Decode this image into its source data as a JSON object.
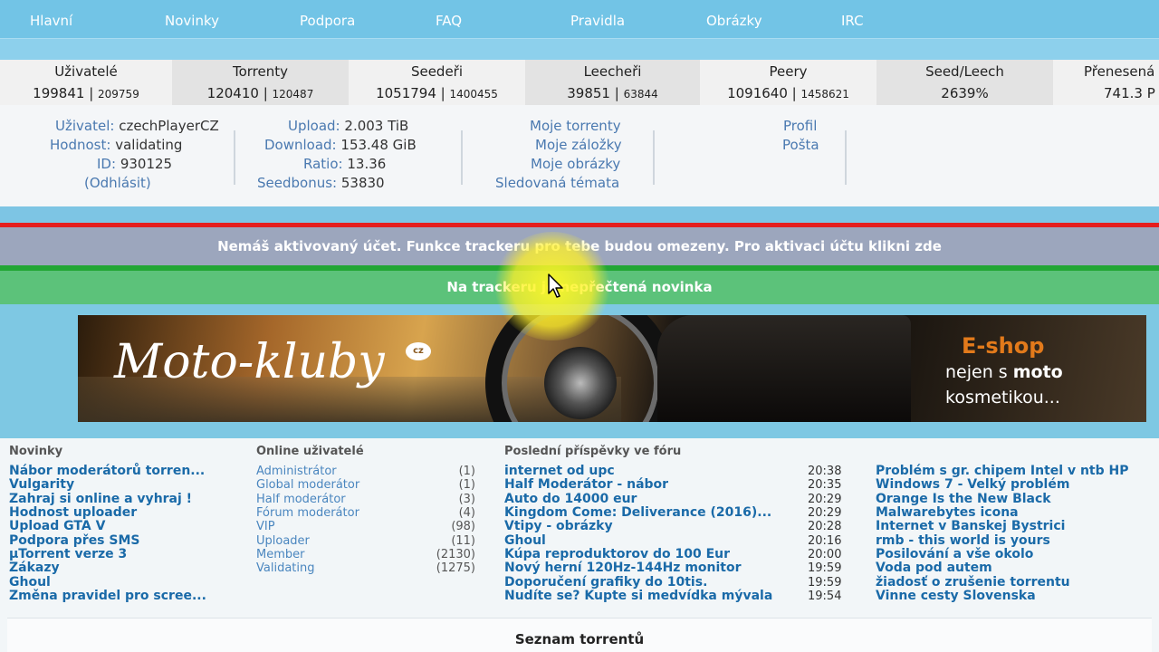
{
  "nav": {
    "items": [
      "Hlavní",
      "Novinky",
      "Podpora",
      "FAQ",
      "Pravidla",
      "Obrázky",
      "IRC"
    ]
  },
  "stats": [
    {
      "label": "Uživatelé",
      "value": "199841",
      "sub": "209759"
    },
    {
      "label": "Torrenty",
      "value": "120410",
      "sub": "120487"
    },
    {
      "label": "Seedeři",
      "value": "1051794",
      "sub": "1400455"
    },
    {
      "label": "Leecheři",
      "value": "39851",
      "sub": "63844"
    },
    {
      "label": "Peery",
      "value": "1091640",
      "sub": "1458621"
    },
    {
      "label": "Seed/Leech",
      "value": "2639%",
      "sub": ""
    },
    {
      "label": "Přenesená",
      "value": "741.3 P",
      "sub": ""
    }
  ],
  "user": {
    "username_label": "Uživatel:",
    "username": "czechPlayerCZ",
    "rank_label": "Hodnost:",
    "rank": "validating",
    "id_label": "ID:",
    "id": "930125",
    "logout": "(Odhlásit)",
    "upload_label": "Upload:",
    "upload": "2.003 TiB",
    "download_label": "Download:",
    "download": "153.48 GiB",
    "ratio_label": "Ratio:",
    "ratio": "13.36",
    "seedbonus_label": "Seedbonus:",
    "seedbonus": "53830"
  },
  "user_links": [
    "Moje torrenty",
    "Moje záložky",
    "Moje obrázky",
    "Sledovaná témata"
  ],
  "profile_links": [
    "Profil",
    "Pošta"
  ],
  "alerts": {
    "warning": "Nemáš aktivovaný účet. Funkce trackeru pro tebe budou omezeny. Pro aktivaci účtu klikni zde",
    "news": "Na trackeru je nepřečtená novinka"
  },
  "banner": {
    "logo": "Moto-kluby",
    "logo_cz": "cz",
    "eshop": "E-shop",
    "line2_a": "nejen s ",
    "line2_b": "moto",
    "line3": "kosmetikou..."
  },
  "news_section": {
    "title": "Novinky",
    "items": [
      "Nábor moderátorů torren...",
      "Vulgarity",
      "Zahraj si online a vyhraj !",
      "Hodnost uploader",
      "Upload GTA V",
      "Podpora přes SMS",
      "µTorrent verze 3",
      "Zákazy",
      "Ghoul",
      "Změna pravidel pro scree..."
    ]
  },
  "online_section": {
    "title": "Online uživatelé",
    "roles": [
      {
        "name": "Administrátor",
        "count": "(1)"
      },
      {
        "name": "Global moderátor",
        "count": "(1)"
      },
      {
        "name": "Half moderátor",
        "count": "(3)"
      },
      {
        "name": "Fórum moderátor",
        "count": "(4)"
      },
      {
        "name": "VIP",
        "count": "(98)"
      },
      {
        "name": "Uploader",
        "count": "(11)"
      },
      {
        "name": "Member",
        "count": "(2130)"
      },
      {
        "name": "Validating",
        "count": "(1275)"
      }
    ]
  },
  "forum_section": {
    "title": "Poslední příspěvky ve fóru",
    "posts": [
      {
        "title": "internet od upc",
        "time": "20:38"
      },
      {
        "title": "Half Moderátor - nábor",
        "time": "20:35"
      },
      {
        "title": "Auto do 14000 eur",
        "time": "20:29"
      },
      {
        "title": "Kingdom Come: Deliverance (2016)...",
        "time": "20:29"
      },
      {
        "title": "Vtipy - obrázky",
        "time": "20:28"
      },
      {
        "title": "Ghoul",
        "time": "20:16"
      },
      {
        "title": "Kúpa reproduktorov do 100 Eur",
        "time": "20:00"
      },
      {
        "title": "Nový herní 120Hz-144Hz monitor",
        "time": "19:59"
      },
      {
        "title": "Doporučení grafiky do 10tis.",
        "time": "19:59"
      },
      {
        "title": "Nudíte se? Kupte si medvídka mývala",
        "time": "19:54"
      }
    ],
    "posts_right": [
      "Problém s gr. chipem Intel v ntb HP",
      "Windows 7 - Velký problém",
      "Orange Is the New Black",
      "Malwarebytes icona",
      "Internet v Banskej Bystrici",
      "rmb - this world is yours",
      "Posilování a vše okolo",
      "Voda pod autem",
      "žiadosť o zrušenie torrentu",
      "Vinne cesty Slovenska"
    ]
  },
  "torrent_list": {
    "title": "Seznam torrentů"
  },
  "colors": {
    "link": "#1a6aa8",
    "warning_bg": "#9ca6bd",
    "news_bg": "#5cc27a",
    "red": "#e51e1e",
    "green": "#23a635"
  },
  "icons": {
    "cursor": "cursor-arrow-icon"
  }
}
